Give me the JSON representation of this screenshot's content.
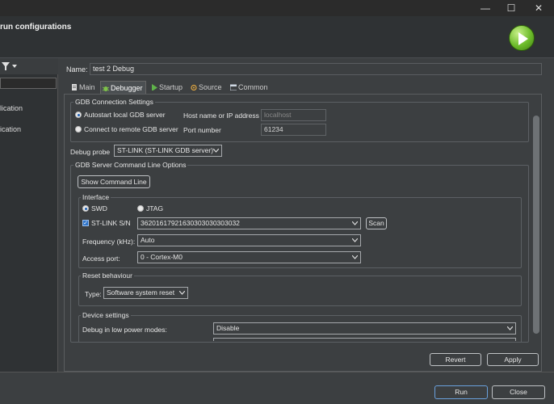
{
  "window": {
    "title": "run configurations",
    "minimize": "—",
    "maximize": "☐",
    "close": "✕"
  },
  "sidebar": {
    "items": [
      "lication",
      "ication"
    ]
  },
  "name": {
    "label": "Name:",
    "value": "test 2 Debug"
  },
  "tabs": [
    "Main",
    "Debugger",
    "Startup",
    "Source",
    "Common"
  ],
  "gdb": {
    "group_title": "GDB Connection Settings",
    "autostart": "Autostart local GDB server",
    "remote": "Connect to remote GDB server",
    "host_label": "Host name or IP address",
    "host_value": "localhost",
    "port_label": "Port number",
    "port_value": "61234"
  },
  "debug_probe": {
    "label": "Debug probe",
    "value": "ST-LINK (ST-LINK GDB server)"
  },
  "gdb_server": {
    "group_title": "GDB Server Command Line Options",
    "show_cmd_button": "Show Command Line"
  },
  "interface": {
    "group_title": "Interface",
    "swd": "SWD",
    "jtag": "JTAG",
    "stlink_sn_label": "ST-LINK S/N",
    "stlink_sn_value": "36201617921630303030303032",
    "scan_button": "Scan",
    "frequency_label": "Frequency (kHz):",
    "frequency_value": "Auto",
    "access_port_label": "Access port:",
    "access_port_value": "0 - Cortex-M0"
  },
  "reset": {
    "group_title": "Reset behaviour",
    "type_label": "Type:",
    "type_value": "Software system reset"
  },
  "device": {
    "group_title": "Device settings",
    "low_power_label": "Debug in low power modes:",
    "low_power_value": "Disable"
  },
  "buttons": {
    "revert": "Revert",
    "apply": "Apply",
    "run": "Run",
    "close": "Close"
  }
}
